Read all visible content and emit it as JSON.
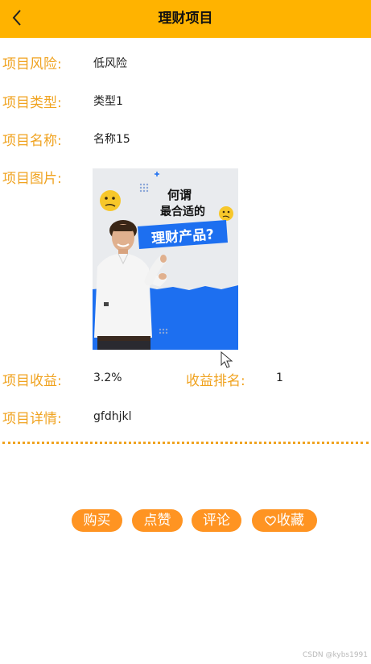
{
  "header": {
    "title": "理财项目",
    "back_icon": "chevron-left-icon",
    "background": "#ffb300"
  },
  "fields": {
    "risk": {
      "label": "项目风险:",
      "value": "低风险"
    },
    "type": {
      "label": "项目类型:",
      "value": "类型1"
    },
    "name": {
      "label": "项目名称:",
      "value": "名称15"
    },
    "image": {
      "label": "项目图片:",
      "image_text_line1": "何谓",
      "image_text_line2": "最合适的",
      "image_text_banner": "理财产品?"
    },
    "income": {
      "label": "项目收益:",
      "value": "3.2%"
    },
    "rank": {
      "label": "收益排名:",
      "value": "1"
    },
    "details": {
      "label": "项目详情:",
      "value": "gfdhjkl"
    }
  },
  "actions": {
    "buy": "购买",
    "like": "点赞",
    "comment": "评论",
    "favorite": "收藏",
    "favorite_icon": "heart-outline-icon",
    "button_color": "#ff9422"
  },
  "label_color": "#f0a320",
  "watermark": "CSDN @kybs1991"
}
